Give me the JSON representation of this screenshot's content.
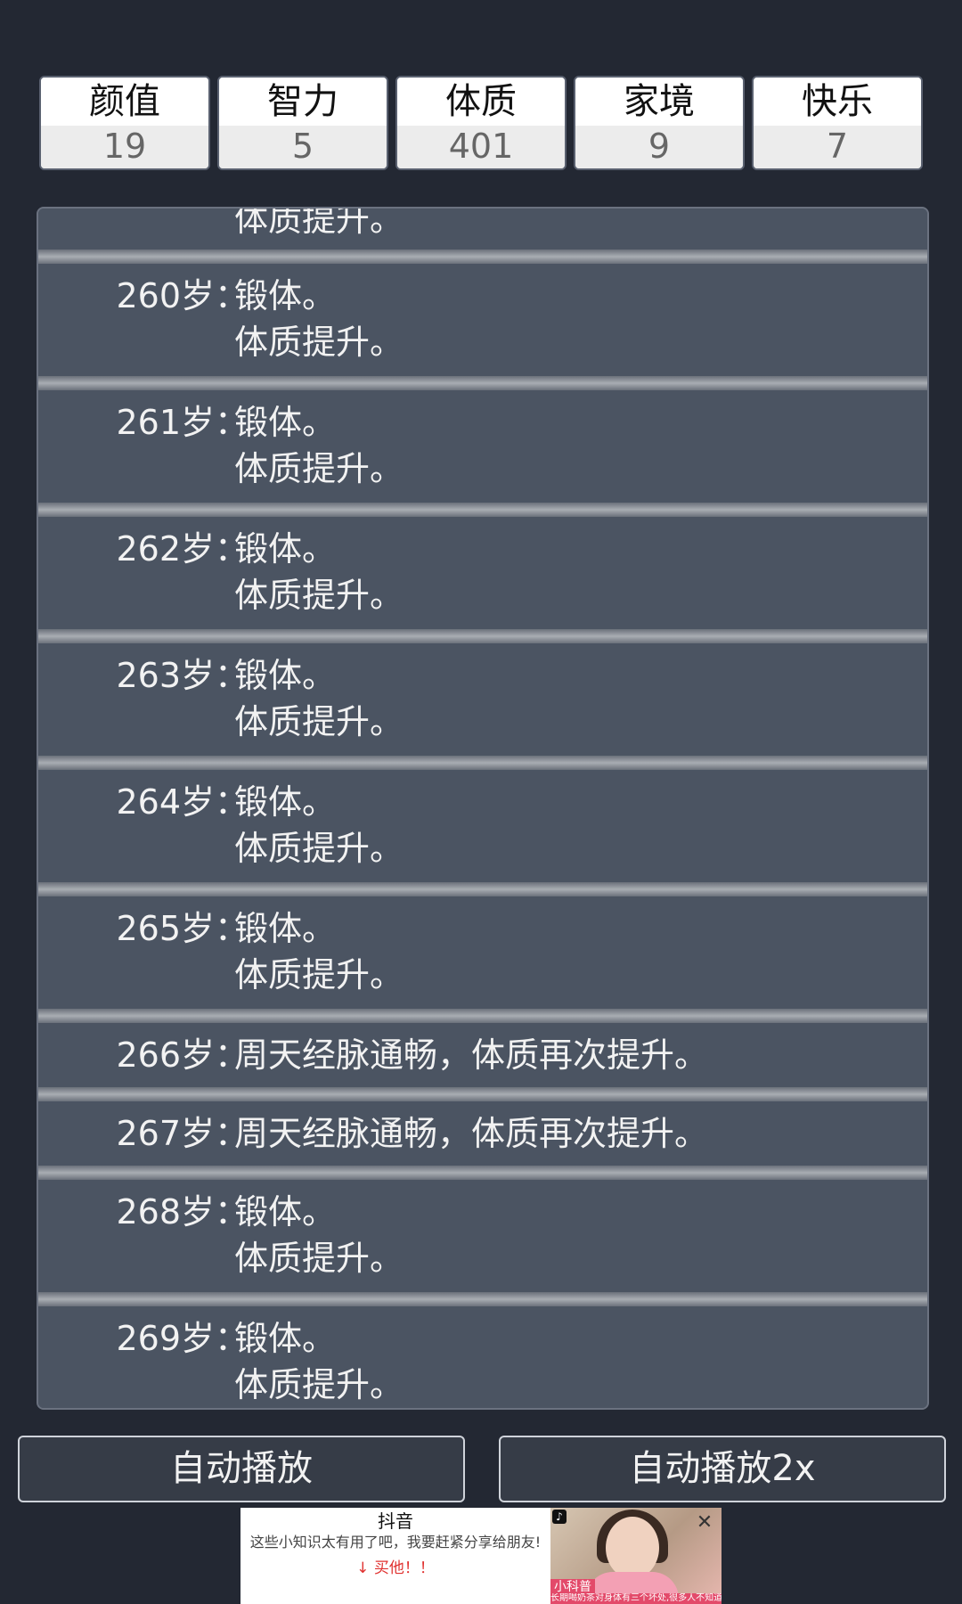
{
  "stats": [
    {
      "label": "颜值",
      "value": "19"
    },
    {
      "label": "智力",
      "value": "5"
    },
    {
      "label": "体质",
      "value": "401"
    },
    {
      "label": "家境",
      "value": "9"
    },
    {
      "label": "快乐",
      "value": "7"
    }
  ],
  "log": {
    "partial_top_line": "体质提升。",
    "entries": [
      {
        "age": "260岁：",
        "lines": [
          "锻体。",
          "体质提升。"
        ]
      },
      {
        "age": "261岁：",
        "lines": [
          "锻体。",
          "体质提升。"
        ]
      },
      {
        "age": "262岁：",
        "lines": [
          "锻体。",
          "体质提升。"
        ]
      },
      {
        "age": "263岁：",
        "lines": [
          "锻体。",
          "体质提升。"
        ]
      },
      {
        "age": "264岁：",
        "lines": [
          "锻体。",
          "体质提升。"
        ]
      },
      {
        "age": "265岁：",
        "lines": [
          "锻体。",
          "体质提升。"
        ]
      },
      {
        "age": "266岁：",
        "lines": [
          "周天经脉通畅，体质再次提升。"
        ]
      },
      {
        "age": "267岁：",
        "lines": [
          "周天经脉通畅，体质再次提升。"
        ]
      },
      {
        "age": "268岁：",
        "lines": [
          "锻体。",
          "体质提升。"
        ]
      },
      {
        "age": "269岁：",
        "lines": [
          "锻体。",
          "体质提升。"
        ]
      }
    ]
  },
  "buttons": {
    "auto_play": "自动播放",
    "auto_play_2x": "自动播放2x"
  },
  "ad": {
    "title": "抖音",
    "description": "这些小知识太有用了吧，我要赶紧分享给朋友!",
    "cta": "↓ 买他！！",
    "brand": "小科普",
    "caption": "长期喝奶茶对身体有三个坏处,很多人不知道",
    "logo_glyph": "♪",
    "close_glyph": "✕"
  }
}
